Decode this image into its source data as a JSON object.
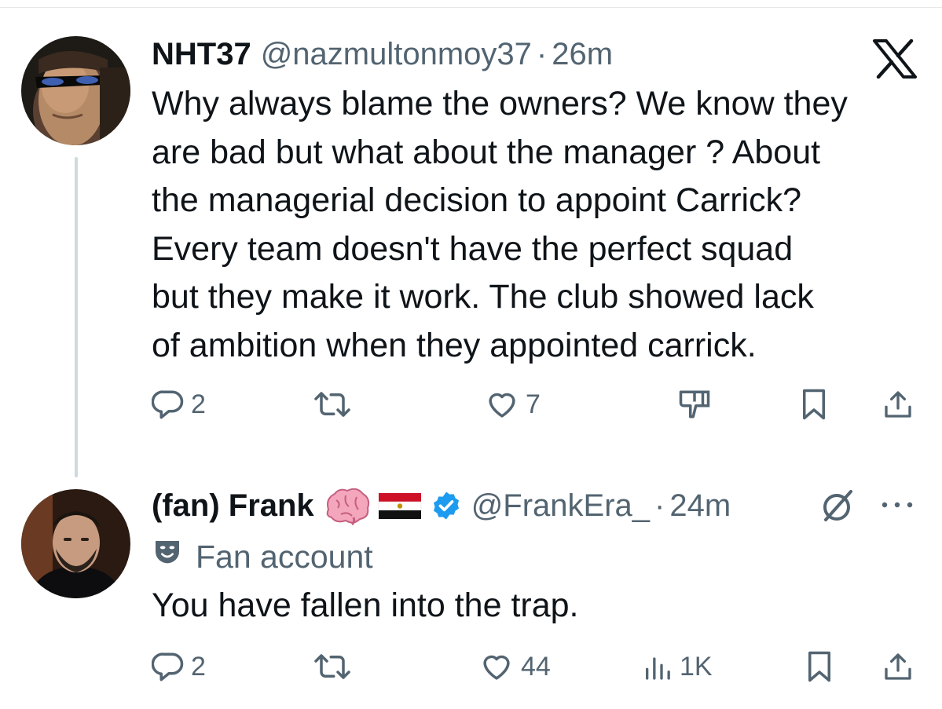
{
  "tweet1": {
    "display_name": "NHT37",
    "handle": "@nazmultonmoy37",
    "separator": "·",
    "time": "26m",
    "lines": [
      "Why always blame the owners? We know they",
      "are bad but what about the manager ? About",
      "the managerial decision to appoint Carrick?",
      "Every team doesn't have the perfect squad",
      "but they make it work. The club showed lack",
      "of ambition when they appointed carrick."
    ],
    "reply_count": "2",
    "like_count": "7",
    "icons": [
      "x-logo",
      "reply-icon",
      "retweet-icon",
      "like-icon",
      "dislike-icon",
      "bookmark-icon",
      "share-icon"
    ]
  },
  "tweet2": {
    "display_name": "(fan) Frank",
    "handle": "@FrankEra_",
    "separator": "·",
    "time": "24m",
    "label": "Fan account",
    "text": "You have fallen into the trap.",
    "reply_count": "2",
    "like_count": "44",
    "views_count": "1K",
    "icons": [
      "brain-emoji",
      "flag-egypt",
      "verified-badge",
      "grok-icon",
      "more-icon",
      "theater-mask-icon",
      "reply-icon",
      "retweet-icon",
      "like-icon",
      "views-icon",
      "bookmark-icon",
      "share-icon"
    ]
  },
  "colors": {
    "text": "#0f1419",
    "secondary": "#536471",
    "verified": "#1d9bf0",
    "thread_line": "#cfd9de"
  }
}
